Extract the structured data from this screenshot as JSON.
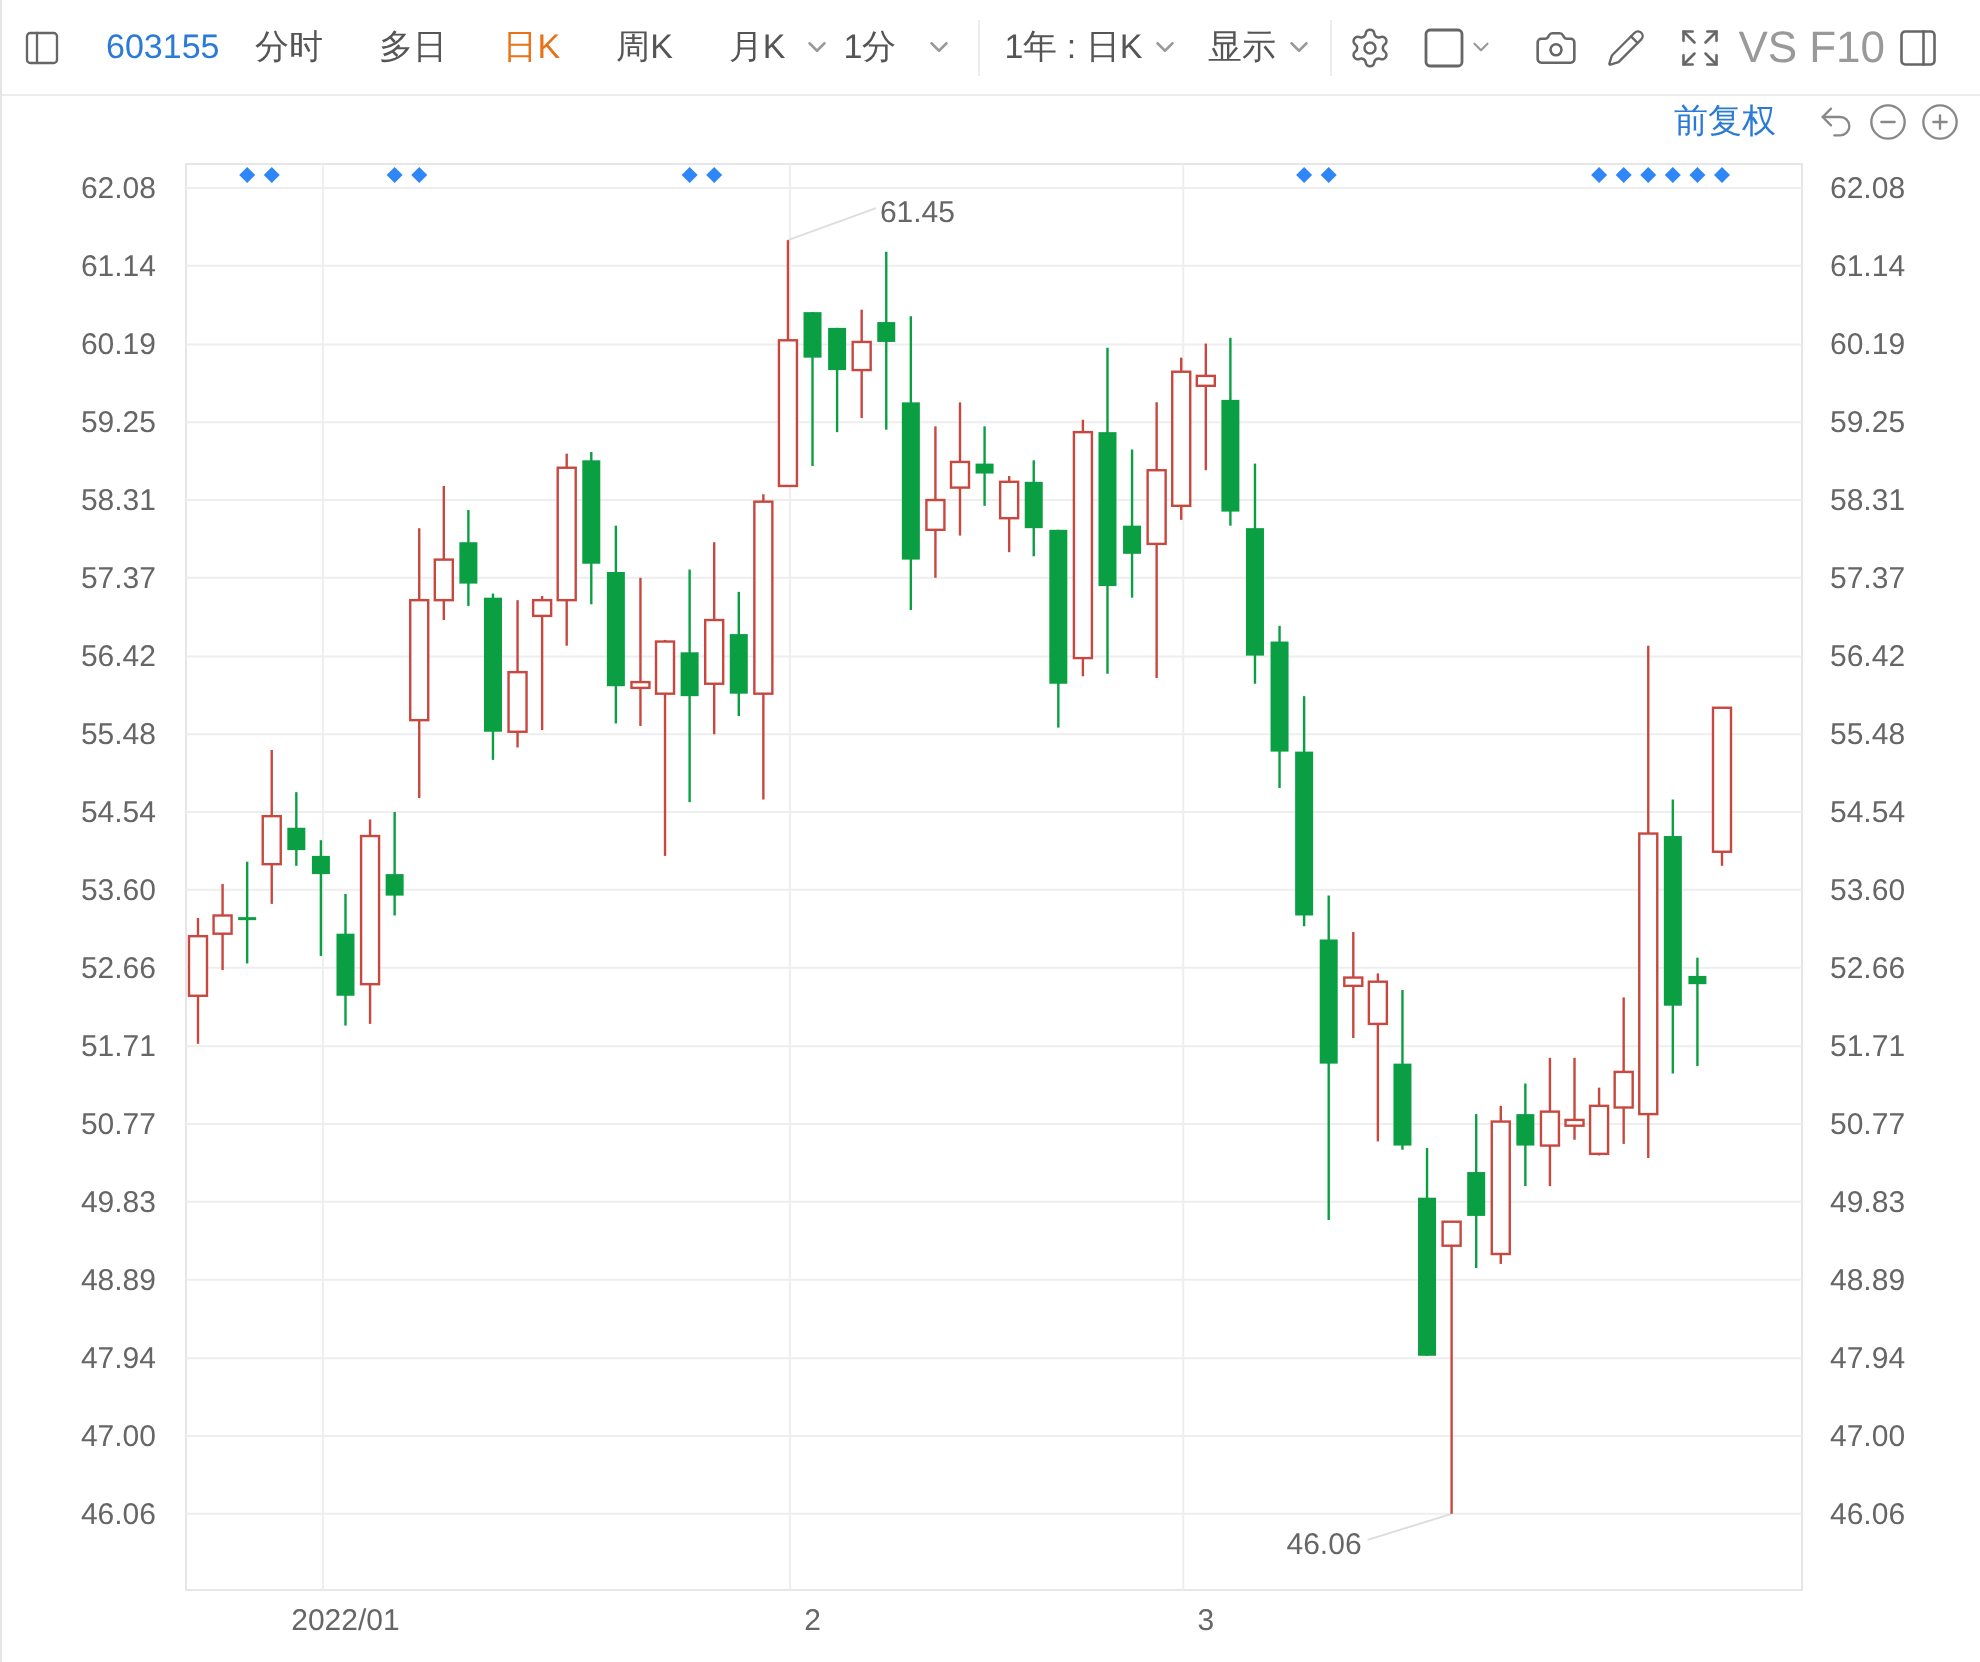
{
  "toolbar": {
    "code": "603155",
    "tabs": [
      {
        "label": "分时",
        "selected": false
      },
      {
        "label": "多日",
        "selected": false
      },
      {
        "label": "日K",
        "selected": true
      },
      {
        "label": "周K",
        "selected": false
      },
      {
        "label": "月K",
        "selected": false
      }
    ],
    "period_dropdown": "1分",
    "range_dropdown": "1年 : 日K",
    "display_dropdown": "显示",
    "vs": "VS",
    "f10": "F10"
  },
  "adjust_link": "前复权",
  "chart": {
    "chart_data": {
      "type": "candlestick",
      "categories": [
        null,
        null,
        null,
        null,
        null,
        null,
        "2022/01",
        null,
        null,
        null,
        null,
        null,
        null,
        null,
        null,
        null,
        null,
        null,
        null,
        null,
        null,
        null,
        null,
        null,
        null,
        "2",
        null,
        null,
        null,
        null,
        null,
        null,
        null,
        null,
        null,
        null,
        null,
        null,
        null,
        null,
        null,
        "3",
        null,
        null,
        null,
        null,
        null,
        null,
        null,
        null,
        null,
        null,
        null,
        null,
        null,
        null,
        null,
        null,
        null,
        null,
        null,
        null,
        null
      ],
      "ohlc": [
        [
          52.32,
          53.26,
          51.74,
          53.04
        ],
        [
          53.07,
          53.67,
          52.63,
          53.29
        ],
        [
          53.27,
          53.94,
          52.71,
          53.25
        ],
        [
          53.91,
          55.29,
          53.43,
          54.49
        ],
        [
          54.35,
          54.78,
          53.89,
          54.08
        ],
        [
          54.01,
          54.2,
          52.8,
          53.79
        ],
        [
          53.07,
          53.55,
          51.96,
          52.32
        ],
        [
          52.46,
          54.45,
          51.98,
          54.25
        ],
        [
          53.79,
          54.54,
          53.29,
          53.53
        ],
        [
          55.65,
          57.97,
          54.71,
          57.1
        ],
        [
          57.1,
          58.48,
          56.86,
          57.59
        ],
        [
          57.8,
          58.19,
          57.03,
          57.3
        ],
        [
          57.13,
          57.18,
          55.17,
          55.51
        ],
        [
          55.51,
          57.1,
          55.32,
          56.23
        ],
        [
          56.91,
          57.15,
          55.53,
          57.1
        ],
        [
          57.1,
          58.87,
          56.55,
          58.7
        ],
        [
          58.79,
          58.89,
          57.05,
          57.54
        ],
        [
          57.44,
          58.0,
          55.61,
          56.06
        ],
        [
          56.04,
          57.37,
          55.58,
          56.11
        ],
        [
          55.97,
          56.62,
          54.01,
          56.6
        ],
        [
          56.47,
          57.47,
          54.66,
          55.94
        ],
        [
          56.09,
          57.8,
          55.48,
          56.86
        ],
        [
          56.69,
          57.2,
          55.7,
          55.97
        ],
        [
          55.97,
          58.38,
          54.69,
          58.29
        ],
        [
          58.48,
          61.45,
          58.48,
          60.24
        ],
        [
          60.58,
          60.58,
          58.72,
          60.03
        ],
        [
          60.39,
          60.39,
          59.13,
          59.88
        ],
        [
          59.88,
          60.61,
          59.3,
          60.22
        ],
        [
          60.46,
          61.31,
          59.16,
          60.22
        ],
        [
          59.49,
          60.53,
          56.98,
          57.59
        ],
        [
          57.95,
          59.2,
          57.37,
          58.31
        ],
        [
          58.46,
          59.49,
          57.88,
          58.77
        ],
        [
          58.75,
          59.2,
          58.24,
          58.63
        ],
        [
          58.09,
          58.6,
          57.68,
          58.53
        ],
        [
          58.53,
          58.79,
          57.63,
          57.97
        ],
        [
          57.95,
          57.95,
          55.56,
          56.09
        ],
        [
          56.4,
          59.28,
          56.18,
          59.13
        ],
        [
          59.13,
          60.15,
          56.21,
          57.27
        ],
        [
          58.0,
          58.92,
          57.13,
          57.66
        ],
        [
          57.78,
          59.49,
          56.16,
          58.67
        ],
        [
          58.24,
          60.03,
          58.07,
          59.86
        ],
        [
          59.69,
          60.2,
          58.67,
          59.81
        ],
        [
          59.52,
          60.27,
          58.0,
          58.17
        ],
        [
          57.97,
          58.75,
          56.09,
          56.43
        ],
        [
          56.6,
          56.79,
          54.83,
          55.27
        ],
        [
          55.27,
          55.94,
          53.16,
          53.29
        ],
        [
          53.0,
          53.53,
          49.61,
          51.5
        ],
        [
          52.44,
          53.09,
          51.81,
          52.54
        ],
        [
          51.98,
          52.59,
          50.56,
          52.49
        ],
        [
          51.5,
          52.39,
          50.46,
          50.51
        ],
        [
          49.88,
          50.48,
          47.97,
          47.97
        ],
        [
          49.3,
          49.59,
          46.06,
          49.59
        ],
        [
          50.19,
          50.89,
          49.03,
          49.66
        ],
        [
          49.2,
          50.99,
          49.08,
          50.8
        ],
        [
          50.89,
          51.26,
          50.02,
          50.51
        ],
        [
          50.51,
          51.57,
          50.02,
          50.92
        ],
        [
          50.75,
          51.57,
          50.58,
          50.82
        ],
        [
          50.41,
          51.21,
          50.39,
          50.99
        ],
        [
          50.97,
          52.3,
          50.53,
          51.4
        ],
        [
          50.89,
          56.55,
          50.36,
          54.28
        ],
        [
          54.25,
          54.69,
          51.38,
          52.2
        ],
        [
          52.56,
          52.78,
          51.47,
          52.46
        ],
        [
          54.06,
          55.8,
          53.89,
          55.8
        ]
      ],
      "ylim": [
        45.14,
        62.37
      ],
      "yticks": [
        62.08,
        61.14,
        60.19,
        59.25,
        58.31,
        57.37,
        56.42,
        55.48,
        54.54,
        {
          "value": 53.6,
          "label": "53.60"
        },
        52.66,
        51.71,
        50.77,
        49.83,
        48.89,
        47.94,
        {
          "value": 47,
          "label": "47.00"
        },
        46.06
      ],
      "y2lim": [
        45.14,
        62.37
      ],
      "y2ticks": [
        62.08,
        61.14,
        60.19,
        59.25,
        58.31,
        57.37,
        56.42,
        55.48,
        54.54,
        {
          "value": 53.6,
          "label": "53.60"
        },
        52.66,
        51.71,
        50.77,
        49.83,
        48.89,
        47.94,
        {
          "value": 47,
          "label": "47.00"
        },
        46.06
      ],
      "grid": true,
      "annotations": [
        "61.45",
        "46.06"
      ]
    },
    "event_markers": [
      {
        "shown": false
      },
      {
        "shown": false
      },
      {
        "shown": true
      },
      {
        "shown": true
      },
      {
        "shown": false
      },
      {
        "shown": false
      },
      {
        "shown": false
      },
      {
        "shown": false
      },
      {
        "shown": true
      },
      {
        "shown": true
      },
      {
        "shown": false
      },
      {
        "shown": false
      },
      {
        "shown": false
      },
      {
        "shown": false
      },
      {
        "shown": false
      },
      {
        "shown": false
      },
      {
        "shown": false
      },
      {
        "shown": false
      },
      {
        "shown": false
      },
      {
        "shown": false
      },
      {
        "shown": true
      },
      {
        "shown": true
      },
      {
        "shown": false
      },
      {
        "shown": false
      },
      {
        "shown": false
      },
      {
        "shown": false
      },
      {
        "shown": false
      },
      {
        "shown": false
      },
      {
        "shown": false
      },
      {
        "shown": false
      },
      {
        "shown": false
      },
      {
        "shown": false
      },
      {
        "shown": false
      },
      {
        "shown": false
      },
      {
        "shown": false
      },
      {
        "shown": false
      },
      {
        "shown": false
      },
      {
        "shown": false
      },
      {
        "shown": false
      },
      {
        "shown": false
      },
      {
        "shown": false
      },
      {
        "shown": false
      },
      {
        "shown": false
      },
      {
        "shown": false
      },
      {
        "shown": false
      },
      {
        "shown": true
      },
      {
        "shown": true
      },
      {
        "shown": false
      },
      {
        "shown": false
      },
      {
        "shown": false
      },
      {
        "shown": false
      },
      {
        "shown": false
      },
      {
        "shown": false
      },
      {
        "shown": false
      },
      {
        "shown": false
      },
      {
        "shown": false
      },
      {
        "shown": false
      },
      {
        "shown": true
      },
      {
        "shown": true
      },
      {
        "shown": true
      },
      {
        "shown": true
      },
      {
        "shown": true
      },
      {
        "shown": true
      }
    ]
  }
}
